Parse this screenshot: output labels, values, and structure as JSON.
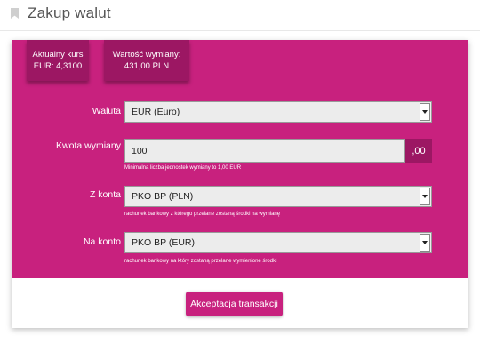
{
  "header": {
    "title": "Zakup walut"
  },
  "info": {
    "rate_label": "Aktualny kurs",
    "rate_value": "EUR: 4,3100",
    "exchange_label": "Wartość wymiany:",
    "exchange_value": "431,00 PLN"
  },
  "form": {
    "currency": {
      "label": "Waluta",
      "value": "EUR (Euro)"
    },
    "amount": {
      "label": "Kwota wymiany",
      "value": "100",
      "suffix": ",00",
      "hint": "Minimalna liczba jednostek wymiany to 1,00 EUR"
    },
    "from_account": {
      "label": "Z konta",
      "value": "PKO BP (PLN)",
      "hint": "rachunek bankowy z którego przelane zostaną środki na wymianę"
    },
    "to_account": {
      "label": "Na konto",
      "value": "PKO BP (EUR)",
      "hint": "rachunek bankowy na który zostaną przelane wymienione środki"
    }
  },
  "actions": {
    "accept_label": "Akceptacja transakcji"
  },
  "colors": {
    "accent": "#c8217e",
    "accent_dark": "#9c1763"
  }
}
